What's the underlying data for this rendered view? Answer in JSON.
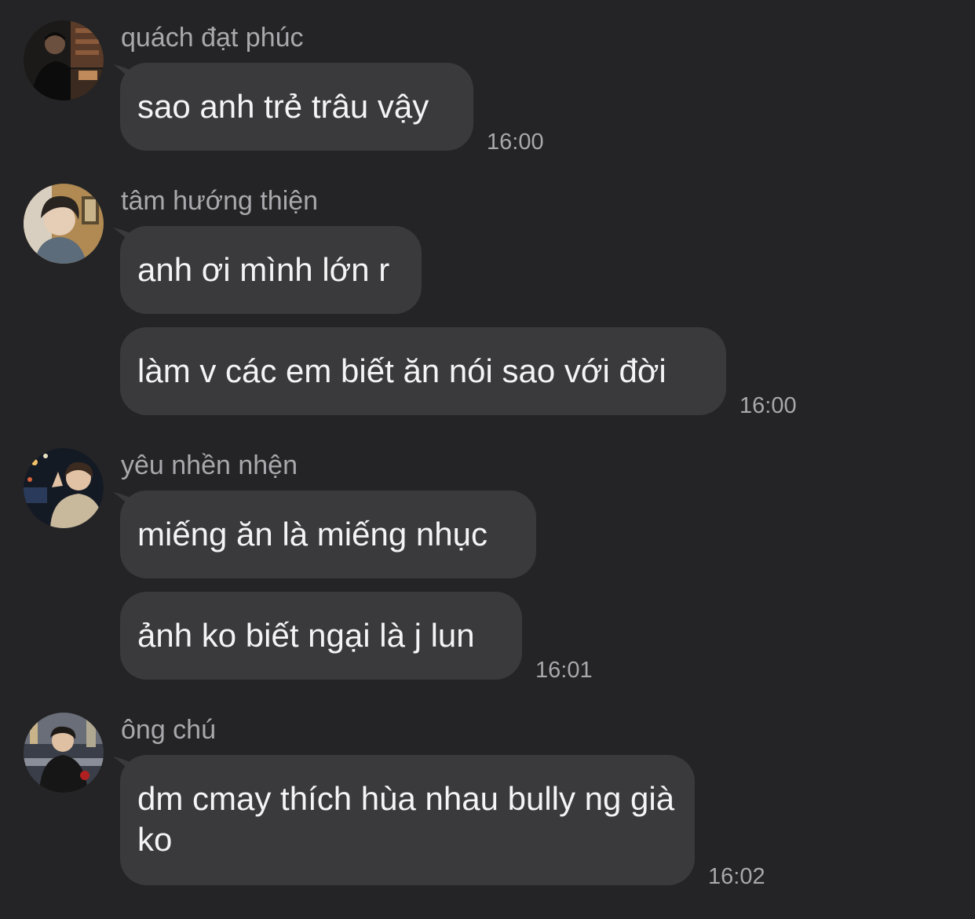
{
  "messages": [
    {
      "sender": "quách đạt phúc",
      "avatar_icon": "user-avatar",
      "bubbles": [
        "sao anh trẻ trâu vậy"
      ],
      "time": "16:00"
    },
    {
      "sender": "tâm hướng thiện",
      "avatar_icon": "user-avatar",
      "bubbles": [
        "anh ơi mình lớn r",
        "làm v các em biết ăn nói sao với đời"
      ],
      "time": "16:00"
    },
    {
      "sender": "yêu nhền nhện",
      "avatar_icon": "user-avatar",
      "bubbles": [
        "miếng ăn là miếng nhục",
        "ảnh ko biết ngại là j lun"
      ],
      "time": "16:01"
    },
    {
      "sender": "ông chú",
      "avatar_icon": "user-avatar",
      "bubbles": [
        "dm cmay thích hùa nhau bully ng già ko"
      ],
      "time": "16:02"
    }
  ],
  "colors": {
    "background": "#242426",
    "bubble": "#3a3a3c",
    "text": "#f4f4f6",
    "meta": "#a8a8ad"
  }
}
